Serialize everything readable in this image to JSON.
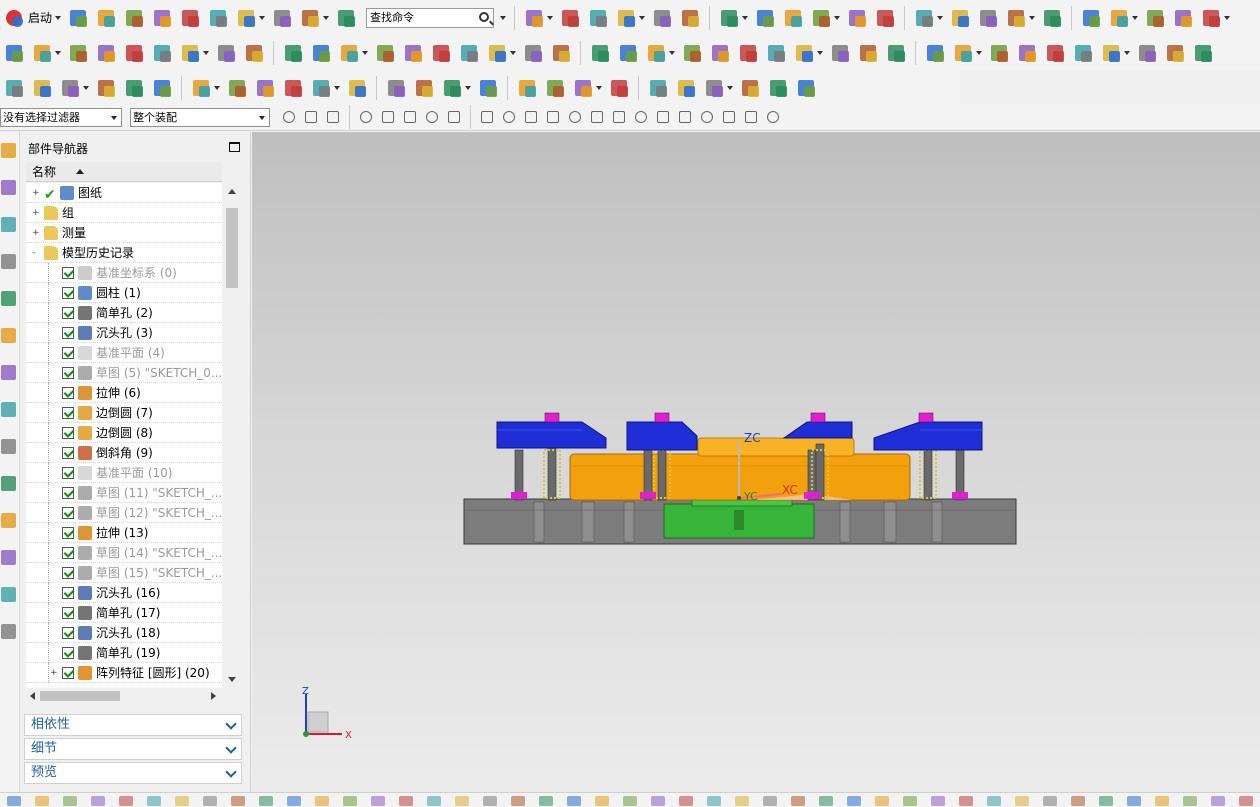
{
  "toolbar": {
    "start_label": "启动",
    "search_value": "查找命令"
  },
  "filters": {
    "selection_filter": "没有选择过滤器",
    "assembly_scope": "整个装配"
  },
  "navigator": {
    "title": "部件导航器",
    "column_name": "名称",
    "items": [
      {
        "label": "图纸",
        "level": 1,
        "expand": "+",
        "state": "normal",
        "icon": "drawing-sheet-icon"
      },
      {
        "label": "组",
        "level": 1,
        "expand": "+",
        "state": "normal",
        "icon": "folder-icon"
      },
      {
        "label": "测量",
        "level": 1,
        "expand": "+",
        "state": "normal",
        "icon": "folder-icon"
      },
      {
        "label": "模型历史记录",
        "level": 1,
        "expand": "-",
        "state": "normal",
        "icon": "folder-icon"
      },
      {
        "label": "基准坐标系 (0)",
        "level": 2,
        "state": "dim",
        "icon": "datum-csys-icon"
      },
      {
        "label": "圆柱 (1)",
        "level": 2,
        "state": "normal",
        "icon": "cylinder-icon"
      },
      {
        "label": "简单孔 (2)",
        "level": 2,
        "state": "normal",
        "icon": "hole-icon"
      },
      {
        "label": "沉头孔 (3)",
        "level": 2,
        "state": "normal",
        "icon": "counterbore-hole-icon"
      },
      {
        "label": "基准平面 (4)",
        "level": 2,
        "state": "dim",
        "icon": "datum-plane-icon"
      },
      {
        "label": "草图 (5) \"SKETCH_0...",
        "level": 2,
        "state": "dim",
        "icon": "sketch-icon"
      },
      {
        "label": "拉伸 (6)",
        "level": 2,
        "state": "normal",
        "icon": "extrude-icon"
      },
      {
        "label": "边倒圆 (7)",
        "level": 2,
        "state": "normal",
        "icon": "edge-blend-icon"
      },
      {
        "label": "边倒圆 (8)",
        "level": 2,
        "state": "normal",
        "icon": "edge-blend-icon"
      },
      {
        "label": "倒斜角 (9)",
        "level": 2,
        "state": "normal",
        "icon": "chamfer-icon"
      },
      {
        "label": "基准平面 (10)",
        "level": 2,
        "state": "dim",
        "icon": "datum-plane-icon"
      },
      {
        "label": "草图 (11) \"SKETCH_...",
        "level": 2,
        "state": "dim",
        "icon": "sketch-icon"
      },
      {
        "label": "草图 (12) \"SKETCH_...",
        "level": 2,
        "state": "dim",
        "icon": "sketch-icon"
      },
      {
        "label": "拉伸 (13)",
        "level": 2,
        "state": "normal",
        "icon": "extrude-icon"
      },
      {
        "label": "草图 (14) \"SKETCH_...",
        "level": 2,
        "state": "dim",
        "icon": "sketch-icon"
      },
      {
        "label": "草图 (15) \"SKETCH_...",
        "level": 2,
        "state": "dim",
        "icon": "sketch-icon"
      },
      {
        "label": "沉头孔 (16)",
        "level": 2,
        "state": "normal",
        "icon": "counterbore-hole-icon"
      },
      {
        "label": "简单孔 (17)",
        "level": 2,
        "state": "normal",
        "icon": "hole-icon"
      },
      {
        "label": "沉头孔 (18)",
        "level": 2,
        "state": "normal",
        "icon": "counterbore-hole-icon"
      },
      {
        "label": "简单孔 (19)",
        "level": 2,
        "state": "normal",
        "icon": "hole-icon"
      },
      {
        "label": "阵列特征 [圆形] (20)",
        "level": 2,
        "expand": "+",
        "state": "normal",
        "icon": "pattern-feature-icon"
      }
    ],
    "panels": [
      {
        "label": "相依性"
      },
      {
        "label": "细节"
      },
      {
        "label": "预览"
      }
    ]
  },
  "viewport": {
    "model_axis_labels": {
      "z": "ZC",
      "y": "YC",
      "x": "XC"
    },
    "triad_labels": {
      "z": "Z",
      "x": "X"
    }
  },
  "colors": {
    "clamp_blue": "#1f2ed6",
    "body_orange": "#f2a00c",
    "base_gray": "#7c7c7c",
    "core_green": "#37b53a",
    "bolt_magenta": "#e020d0",
    "spring_yellow": "#d9c341",
    "panel_blue": "#1f5fa8"
  }
}
